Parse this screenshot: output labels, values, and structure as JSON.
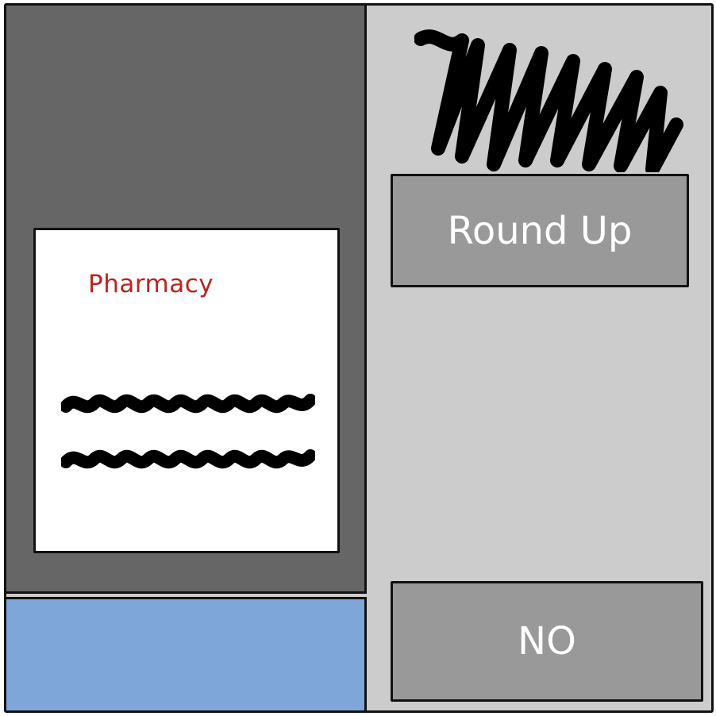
{
  "receipt": {
    "merchant": "Pharmacy"
  },
  "actions": {
    "round_up_label": "Round Up",
    "no_label": "NO"
  },
  "colors": {
    "left_panel": "#666666",
    "right_panel": "#cccccc",
    "receipt_bg": "#ffffff",
    "merchant_text": "#b8261f",
    "button_bg": "#999999",
    "button_text": "#ffffff",
    "bottom_bar": "#7ea6d8"
  },
  "icons": {
    "heading_placeholder": "scribble-redacted-heading",
    "receipt_lines": "scribble-redacted-text"
  }
}
